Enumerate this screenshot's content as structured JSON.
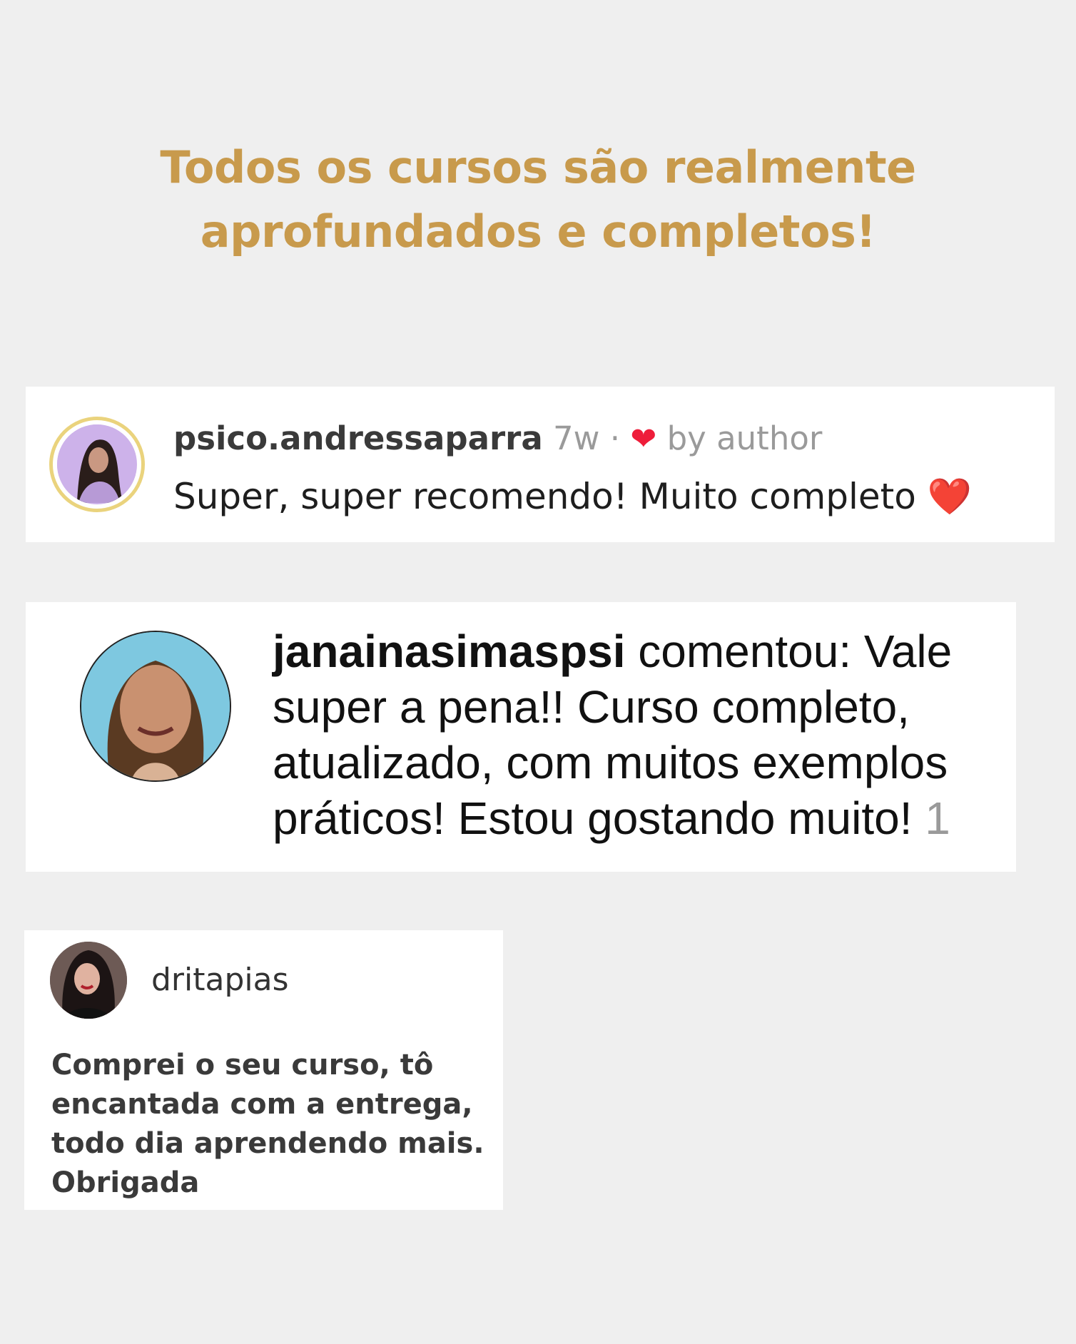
{
  "headline": {
    "line1": "Todos os cursos são realmente",
    "line2": "aprofundados e completos!",
    "color": "#c89a4c"
  },
  "comments": [
    {
      "username": "psico.andressaparra",
      "time": "7w",
      "separator": "·",
      "liked_by": "by author",
      "text": "Super, super recomendo! Muito completo",
      "emoji": "❤️",
      "avatar_icon": "profile-photo-icon"
    },
    {
      "username": "janainasimaspsi",
      "lines": [
        " comentou: Vale",
        "super a pena!! Curso completo,",
        "atualizado, com muitos exemplos",
        "práticos! Estou gostando muito! "
      ],
      "count": "1",
      "avatar_icon": "profile-photo-icon"
    },
    {
      "username": "dritapias",
      "lines": [
        "Comprei o seu curso, tô",
        "encantada com a entrega,",
        "todo dia aprendendo mais.",
        "Obrigada"
      ],
      "avatar_icon": "profile-photo-icon"
    }
  ]
}
